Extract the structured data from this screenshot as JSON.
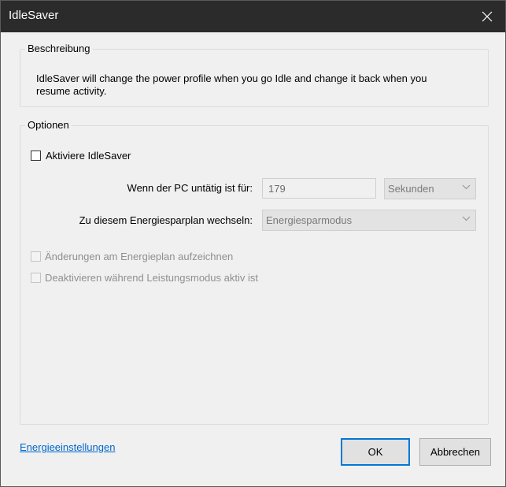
{
  "window": {
    "title": "IdleSaver"
  },
  "description": {
    "legend": "Beschreibung",
    "text": "IdleSaver will change the power profile when you go Idle and change it back when you resume activity."
  },
  "options": {
    "legend": "Optionen",
    "activate": {
      "label": "Aktiviere IdleSaver",
      "checked": false,
      "enabled": true
    },
    "idle_time": {
      "label": "Wenn der PC untätig ist für:",
      "value": "179",
      "unit": "Sekunden",
      "enabled": false
    },
    "power_plan": {
      "label": "Zu diesem Energiesparplan wechseln:",
      "value": "Energiesparmodus",
      "enabled": false
    },
    "record_changes": {
      "label": "Änderungen am Energieplan aufzeichnen",
      "checked": false,
      "enabled": false
    },
    "disable_performance": {
      "label": "Deaktivieren während Leistungsmodus aktiv ist",
      "checked": false,
      "enabled": false
    }
  },
  "footer": {
    "link": "Energieeinstellungen",
    "ok": "OK",
    "cancel": "Abbrechen"
  },
  "colors": {
    "titlebar": "#2b2b2b",
    "link": "#0066cc",
    "accent": "#0078d7"
  },
  "icons": {
    "close": "close-icon",
    "dropdown": "chevron-down-icon"
  }
}
